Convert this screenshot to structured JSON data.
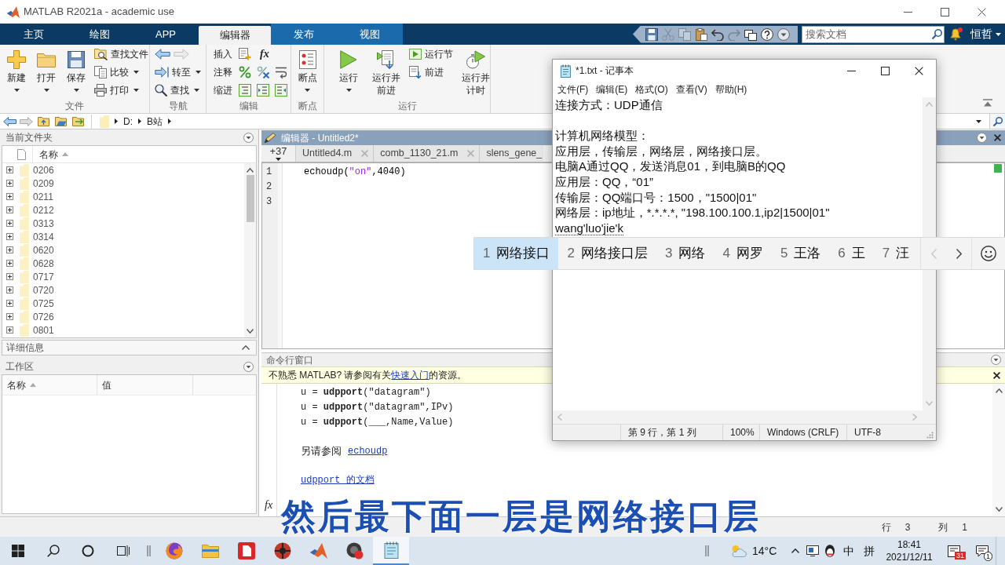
{
  "window": {
    "title": "MATLAB R2021a - academic use"
  },
  "ribbon_tabs": [
    {
      "label": "主页",
      "kind": "main",
      "selected": false
    },
    {
      "label": "绘图",
      "kind": "main",
      "selected": false
    },
    {
      "label": "APP",
      "kind": "main",
      "selected": false
    },
    {
      "label": "编辑器",
      "kind": "contextual",
      "selected": true
    },
    {
      "label": "发布",
      "kind": "contextual",
      "selected": false
    },
    {
      "label": "视图",
      "kind": "contextual",
      "selected": false
    }
  ],
  "quick_access": {
    "tools": [
      {
        "disabled": false
      },
      {
        "disabled": true
      },
      {
        "disabled": true
      },
      {
        "disabled": false
      },
      {
        "disabled": false
      },
      {
        "disabled": true
      },
      {
        "disabled": false
      },
      {
        "disabled": false
      },
      {
        "disabled": false
      }
    ],
    "search": {
      "placeholder": "搜索文档"
    },
    "user": "恒哲"
  },
  "ribbon_groups": [
    {
      "label": "文件",
      "items": [
        {
          "label": "新建",
          "kind": "large",
          "menu": true
        },
        {
          "label": "打开",
          "kind": "large",
          "menu": true
        },
        {
          "label": "保存",
          "kind": "large",
          "menu": true
        },
        {
          "label": "查找文件",
          "kind": "small",
          "menu": false
        },
        {
          "label": "比较",
          "kind": "small",
          "menu": true
        },
        {
          "label": "打印",
          "kind": "small",
          "menu": true
        }
      ]
    },
    {
      "label": "导航",
      "items": [
        {
          "label": "转至",
          "kind": "small",
          "menu": true
        },
        {
          "label": "查找",
          "kind": "small",
          "menu": true
        }
      ]
    },
    {
      "label": "编辑",
      "items": [
        {
          "label": "插入",
          "kind": "row",
          "menu": false,
          "symbol": "fx"
        },
        {
          "label": "注释",
          "kind": "row",
          "menu": false
        },
        {
          "label": "缩进",
          "kind": "row",
          "menu": false
        }
      ]
    },
    {
      "label": "断点",
      "items": [
        {
          "label": "断点",
          "kind": "large",
          "menu": true
        }
      ]
    },
    {
      "label": "运行",
      "items": [
        {
          "label": "运行",
          "kind": "large",
          "menu": true
        },
        {
          "label": "运行并前进",
          "kind": "large",
          "menu": false
        },
        {
          "label": "运行节",
          "kind": "small",
          "menu": false
        },
        {
          "label": "前进",
          "kind": "small",
          "menu": false
        },
        {
          "label": "运行并计时",
          "kind": "large",
          "menu": false
        }
      ]
    }
  ],
  "address_bar": {
    "path": [
      "D:",
      "B站"
    ]
  },
  "current_folder": {
    "title": "当前文件夹",
    "column": "名称",
    "rows": [
      {
        "name": "0206",
        "expanded": false
      },
      {
        "name": "0209",
        "expanded": false
      },
      {
        "name": "0211",
        "expanded": false
      },
      {
        "name": "0212",
        "expanded": false
      },
      {
        "name": "0313",
        "expanded": false
      },
      {
        "name": "0314",
        "expanded": false
      },
      {
        "name": "0620",
        "expanded": false
      },
      {
        "name": "0628",
        "expanded": false
      },
      {
        "name": "0717",
        "expanded": false
      },
      {
        "name": "0720",
        "expanded": false
      },
      {
        "name": "0725",
        "expanded": false
      },
      {
        "name": "0726",
        "expanded": false
      },
      {
        "name": "0801",
        "expanded": false
      }
    ]
  },
  "details": {
    "title": "详细信息"
  },
  "workspace": {
    "title": "工作区",
    "columns": [
      "名称",
      "值"
    ]
  },
  "editor": {
    "title": "编辑器 - Untitled2*",
    "hidden_tab_count": "+37",
    "tabs": [
      {
        "label": "Untitled4.m",
        "selected": false
      },
      {
        "label": "comb_1130_21.m",
        "selected": false
      },
      {
        "label": "slens_gene_",
        "selected": false
      }
    ],
    "lines": [
      {
        "number": "1",
        "tokens": [
          {
            "text": "echoudp(",
            "kind": "plain"
          },
          {
            "text": "\"on\"",
            "kind": "string"
          },
          {
            "text": ",4040)",
            "kind": "plain"
          }
        ]
      },
      {
        "number": "2"
      },
      {
        "number": "3"
      }
    ]
  },
  "command_window": {
    "title": "命令行窗口",
    "notice": {
      "text_before": "不熟悉 MATLAB? 请参阅有关",
      "link": "快速入门",
      "text_after": "的资源。"
    },
    "output": [
      {
        "kind": "code",
        "text": "u = **udpport**(\"datagram\")"
      },
      {
        "kind": "code",
        "text": "u = **udpport**(\"datagram\",IPv)"
      },
      {
        "kind": "code",
        "text": "u = **udpport**(___,Name,Value)"
      },
      {
        "kind": "see_also",
        "label": "另请参阅",
        "link": "echoudp"
      },
      {
        "kind": "link",
        "text": "udpport 的文档"
      }
    ],
    "prompt": "fx"
  },
  "status_bar": [
    {
      "label": "行",
      "value": "3"
    },
    {
      "label": "列",
      "value": "1"
    }
  ],
  "notepad": {
    "title": "*1.txt - 记事本",
    "menu": [
      "文件(F)",
      "编辑(E)",
      "格式(O)",
      "查看(V)",
      "帮助(H)"
    ],
    "paragraphs": [
      [
        "连接方式：UDP通信"
      ],
      [
        "计算机网络模型：",
        "应用层，传输层，网络层，网络接口层。",
        "电脑A通过QQ，发送消息01，到电脑B的QQ",
        "应用层：QQ，“01”",
        "传输层：QQ端口号：1500，\"1500|01\"",
        "网络层：ip地址，*.*.*.*, \"198.100.100.1,ip2|1500|01\""
      ]
    ],
    "composition": "wang'luo'jie'k",
    "status": [
      "第 9 行，第 1 列",
      "100%",
      "Windows (CRLF)",
      "UTF-8"
    ]
  },
  "ime": {
    "candidates": [
      {
        "number": "1",
        "text": "网络接口",
        "selected": true
      },
      {
        "number": "2",
        "text": "网络接口层",
        "selected": false
      },
      {
        "number": "3",
        "text": "网络",
        "selected": false
      },
      {
        "number": "4",
        "text": "网罗",
        "selected": false
      },
      {
        "number": "5",
        "text": "王洛",
        "selected": false
      },
      {
        "number": "6",
        "text": "王",
        "selected": false
      },
      {
        "number": "7",
        "text": "汪",
        "selected": false
      }
    ],
    "prev": {
      "disabled": true
    },
    "next": {
      "disabled": false
    }
  },
  "taskbar": {
    "apps": [
      {
        "selected": false
      },
      {
        "selected": false
      },
      {
        "selected": false
      },
      {
        "selected": false
      },
      {
        "selected": false
      },
      {
        "selected": false
      },
      {
        "selected": true
      }
    ],
    "tray": {
      "temperature": "14°C",
      "input_mode": "中",
      "ime_mode": "拼",
      "time": "18:41",
      "date": "2021/12/11",
      "badges": [
        "31",
        "1"
      ]
    }
  },
  "subtitle": "然后最下面一层是网络接口层"
}
